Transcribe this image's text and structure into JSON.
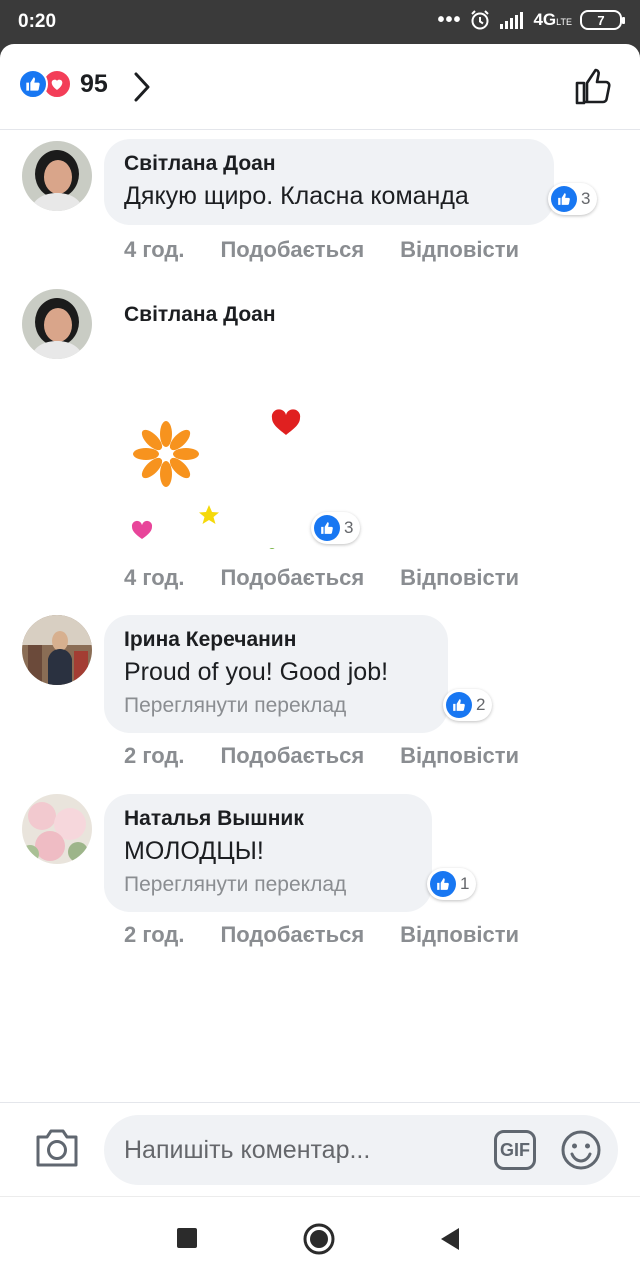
{
  "status": {
    "time": "0:20",
    "network": "4G",
    "network_sub": "LTE",
    "battery": "7"
  },
  "header": {
    "reaction_count": "95"
  },
  "colors": {
    "like_blue": "#1877f2",
    "love_red": "#f33e58",
    "bubble": "#f0f2f5",
    "meta_gray": "#8a8d91"
  },
  "comments": [
    {
      "author": "Світлана Доан",
      "text": "Дякую щиро. Класна команда",
      "likes": "3",
      "time": "4 год.",
      "like_label": "Подобається",
      "reply_label": "Відповісти"
    },
    {
      "author": "Світлана Доан",
      "sticker": "flowers-hearts-sticker",
      "likes": "3",
      "time": "4 год.",
      "like_label": "Подобається",
      "reply_label": "Відповісти"
    },
    {
      "author": "Ірина Керечанин",
      "text": "Proud of you! Good job!",
      "translate": "Переглянути переклад",
      "likes": "2",
      "time": "2 год.",
      "like_label": "Подобається",
      "reply_label": "Відповісти"
    },
    {
      "author": "Наталья Вышник",
      "text": "МОЛОДЦЫ!",
      "translate": "Переглянути переклад",
      "likes": "1",
      "time": "2 год.",
      "like_label": "Подобається",
      "reply_label": "Відповісти"
    }
  ],
  "composer": {
    "placeholder": "Напишіть коментар...",
    "gif_label": "GIF"
  },
  "icons": [
    "like-icon",
    "love-icon",
    "chevron-right-icon",
    "thumbs-up-outline-icon",
    "camera-icon",
    "gif-icon",
    "smiley-icon",
    "square-nav-icon",
    "circle-nav-icon",
    "back-triangle-icon"
  ]
}
